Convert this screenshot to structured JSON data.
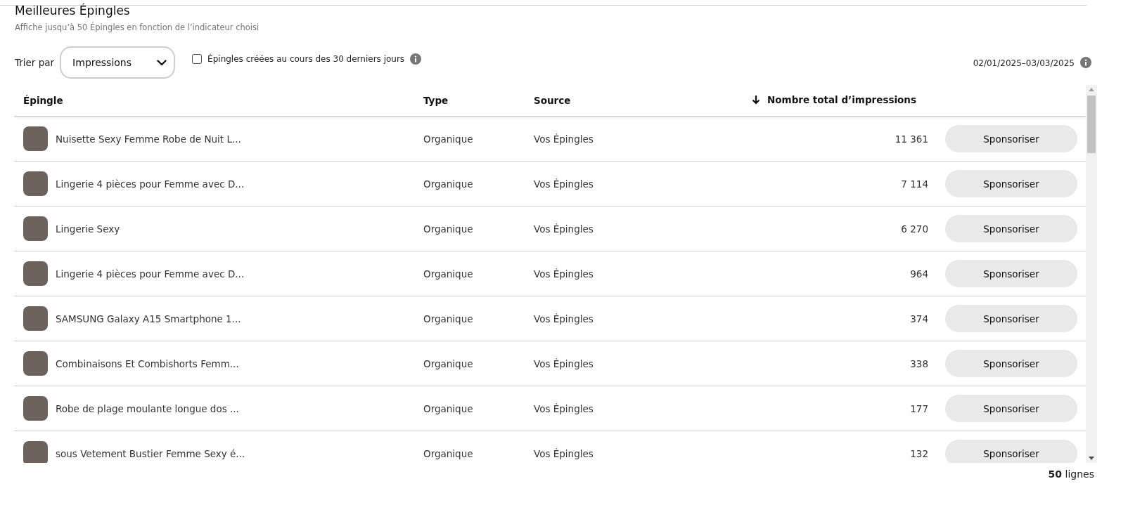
{
  "title": "Meilleures Épingles",
  "subtitle": "Affiche jusqu’à 50 Épingles en fonction de l’indicateur choisi",
  "sort": {
    "label": "Trier par",
    "value": "Impressions"
  },
  "filter": {
    "label": "Épingles créées au cours des 30 derniers jours",
    "checked": false
  },
  "date_range": "02/01/2025–03/03/2025",
  "table": {
    "columns": [
      {
        "label": "Épingle",
        "sorted": false
      },
      {
        "label": "Type",
        "sorted": false
      },
      {
        "label": "Source",
        "sorted": false
      },
      {
        "label": "Nombre total d’impressions",
        "sorted": true
      }
    ],
    "rows": [
      {
        "pin": "Nuisette Sexy Femme Robe de Nuit L...",
        "type": "Organique",
        "source": "Vos Épingles",
        "impressions": "11 361",
        "action": "Sponsoriser"
      },
      {
        "pin": "Lingerie 4 pièces pour Femme avec D...",
        "type": "Organique",
        "source": "Vos Épingles",
        "impressions": "7 114",
        "action": "Sponsoriser"
      },
      {
        "pin": "Lingerie Sexy",
        "type": "Organique",
        "source": "Vos Épingles",
        "impressions": "6 270",
        "action": "Sponsoriser"
      },
      {
        "pin": "Lingerie 4 pièces pour Femme avec D...",
        "type": "Organique",
        "source": "Vos Épingles",
        "impressions": "964",
        "action": "Sponsoriser"
      },
      {
        "pin": "SAMSUNG Galaxy A15 Smartphone 1...",
        "type": "Organique",
        "source": "Vos Épingles",
        "impressions": "374",
        "action": "Sponsoriser"
      },
      {
        "pin": "Combinaisons Et Combishorts Femm...",
        "type": "Organique",
        "source": "Vos Épingles",
        "impressions": "338",
        "action": "Sponsoriser"
      },
      {
        "pin": "Robe de plage moulante longue dos ...",
        "type": "Organique",
        "source": "Vos Épingles",
        "impressions": "177",
        "action": "Sponsoriser"
      },
      {
        "pin": "sous Vetement Bustier Femme Sexy é...",
        "type": "Organique",
        "source": "Vos Épingles",
        "impressions": "132",
        "action": "Sponsoriser"
      }
    ]
  },
  "row_count": "**50** lignes"
}
